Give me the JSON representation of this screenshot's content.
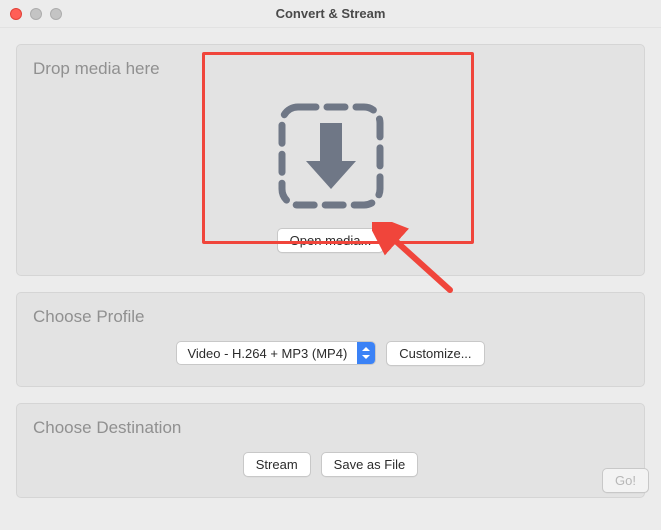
{
  "window": {
    "title": "Convert & Stream"
  },
  "dropSection": {
    "title": "Drop media here",
    "openButton": "Open media..."
  },
  "profileSection": {
    "title": "Choose Profile",
    "selected": "Video - H.264 + MP3 (MP4)",
    "customizeButton": "Customize..."
  },
  "destinationSection": {
    "title": "Choose Destination",
    "streamButton": "Stream",
    "saveButton": "Save as File"
  },
  "footer": {
    "goButton": "Go!"
  }
}
